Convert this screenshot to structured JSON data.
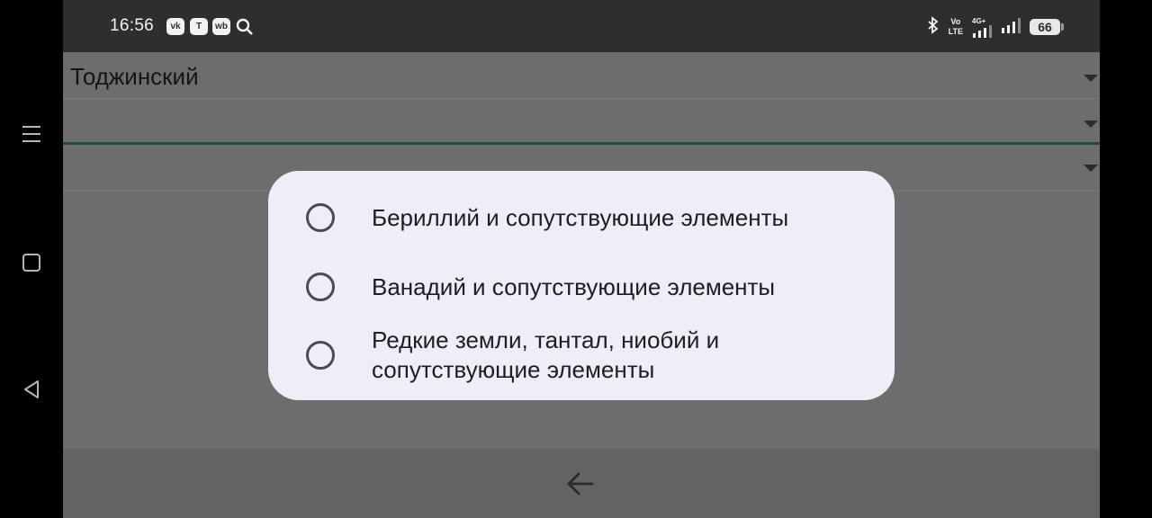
{
  "status_bar": {
    "time": "16:56",
    "app_icons": [
      "vk-icon",
      "t-app-icon",
      "wb-icon",
      "search-icon"
    ],
    "app_icon_labels": [
      "vk",
      "T",
      "wb"
    ],
    "volte_label": "Vo",
    "lte_label": "LTE",
    "network_label": "4G+",
    "battery_level": "66"
  },
  "form": {
    "district_value": "Тоджинский",
    "field2_value": "",
    "field3_value": ""
  },
  "dialog": {
    "options": [
      {
        "label": "Бериллий и сопутствующие элементы",
        "selected": false
      },
      {
        "label": "Ванадий и сопутствующие элементы",
        "selected": false
      },
      {
        "label": "Редкие земли, тантал, ниобий и сопутствующие элементы",
        "selected": false
      }
    ]
  },
  "navigation": {
    "menu_icon": "hamburger-icon",
    "home_icon": "square-icon",
    "back_icon": "triangle-back-icon",
    "app_back_icon": "arrow-left-icon"
  }
}
